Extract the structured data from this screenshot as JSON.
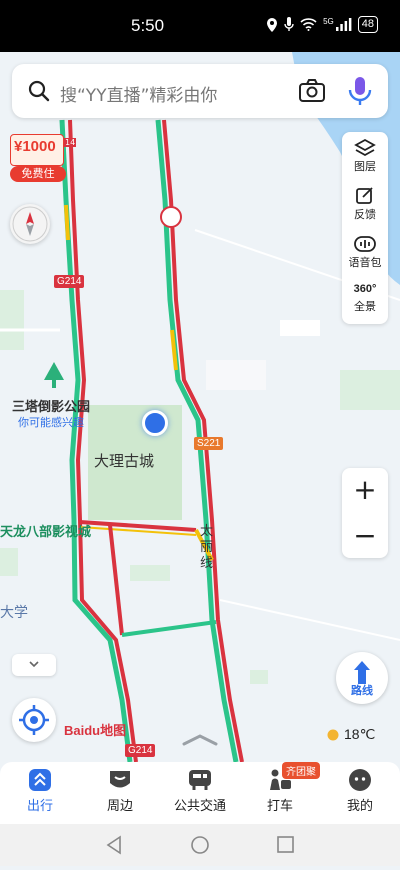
{
  "status_bar": {
    "time": "5:50",
    "battery": "48",
    "network": "5G"
  },
  "search": {
    "placeholder": "搜“YY直播”精彩由你"
  },
  "promo": {
    "amount": "¥1000",
    "label": "免费住",
    "road_tag": "14"
  },
  "tools": [
    {
      "label": "图层",
      "icon": "layers-icon"
    },
    {
      "label": "反馈",
      "icon": "edit-icon"
    },
    {
      "label": "语音包",
      "icon": "voice-icon"
    },
    {
      "label": "全景",
      "icon": "panorama-icon",
      "badge": "360°"
    }
  ],
  "zoom": {
    "in": "+",
    "out": "−"
  },
  "map_labels": {
    "park": "三塔倒影公园",
    "park_sub": "你可能感兴趣",
    "old_town": "大理古城",
    "road_taili": "太丽线",
    "film_city": "天龙八部影视城",
    "university": "大学",
    "g214_top": "G214",
    "g214_bottom": "G214",
    "s221": "S221"
  },
  "route_button": {
    "label": "路线"
  },
  "weather": {
    "temp": "18℃"
  },
  "logo": "Baidu地图",
  "nav": [
    {
      "label": "出行",
      "active": true
    },
    {
      "label": "周边",
      "active": false
    },
    {
      "label": "公共交通",
      "active": false
    },
    {
      "label": "打车",
      "active": false,
      "badge": "齐团聚"
    },
    {
      "label": "我的",
      "active": false
    }
  ],
  "colors": {
    "accent": "#2f6fe6",
    "traffic_red": "#d9333f",
    "traffic_green": "#2bc48a",
    "traffic_yellow": "#f3c10a",
    "park_green": "#cfe8cf"
  }
}
